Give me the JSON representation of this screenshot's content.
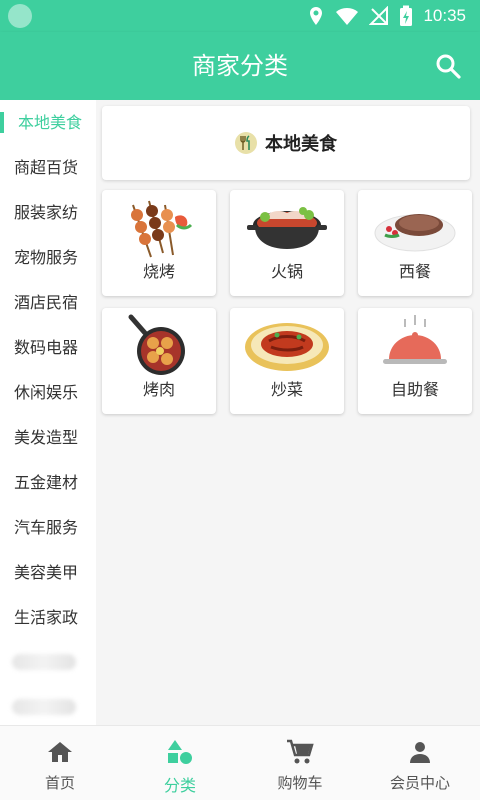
{
  "status_bar": {
    "time": "10:35"
  },
  "header": {
    "title": "商家分类"
  },
  "sidebar": {
    "items": [
      {
        "label": "本地美食",
        "active": true
      },
      {
        "label": "商超百货"
      },
      {
        "label": "服装家纺"
      },
      {
        "label": "宠物服务"
      },
      {
        "label": "酒店民宿"
      },
      {
        "label": "数码电器"
      },
      {
        "label": "休闲娱乐"
      },
      {
        "label": "美发造型"
      },
      {
        "label": "五金建材"
      },
      {
        "label": "汽车服务"
      },
      {
        "label": "美容美甲"
      },
      {
        "label": "生活家政"
      }
    ]
  },
  "content": {
    "section_title": "本地美食",
    "subcategories": [
      {
        "label": "烧烤",
        "icon": "skewers-icon"
      },
      {
        "label": "火锅",
        "icon": "hotpot-icon"
      },
      {
        "label": "西餐",
        "icon": "steak-icon"
      },
      {
        "label": "烤肉",
        "icon": "grill-pan-icon"
      },
      {
        "label": "炒菜",
        "icon": "stir-fry-icon"
      },
      {
        "label": "自助餐",
        "icon": "cloche-icon"
      }
    ]
  },
  "bottom_nav": {
    "items": [
      {
        "label": "首页",
        "icon": "home-icon"
      },
      {
        "label": "分类",
        "icon": "category-icon",
        "active": true
      },
      {
        "label": "购物车",
        "icon": "cart-icon"
      },
      {
        "label": "会员中心",
        "icon": "person-icon"
      }
    ]
  },
  "colors": {
    "accent": "#3ecf9e",
    "background": "#f5f5f5"
  }
}
